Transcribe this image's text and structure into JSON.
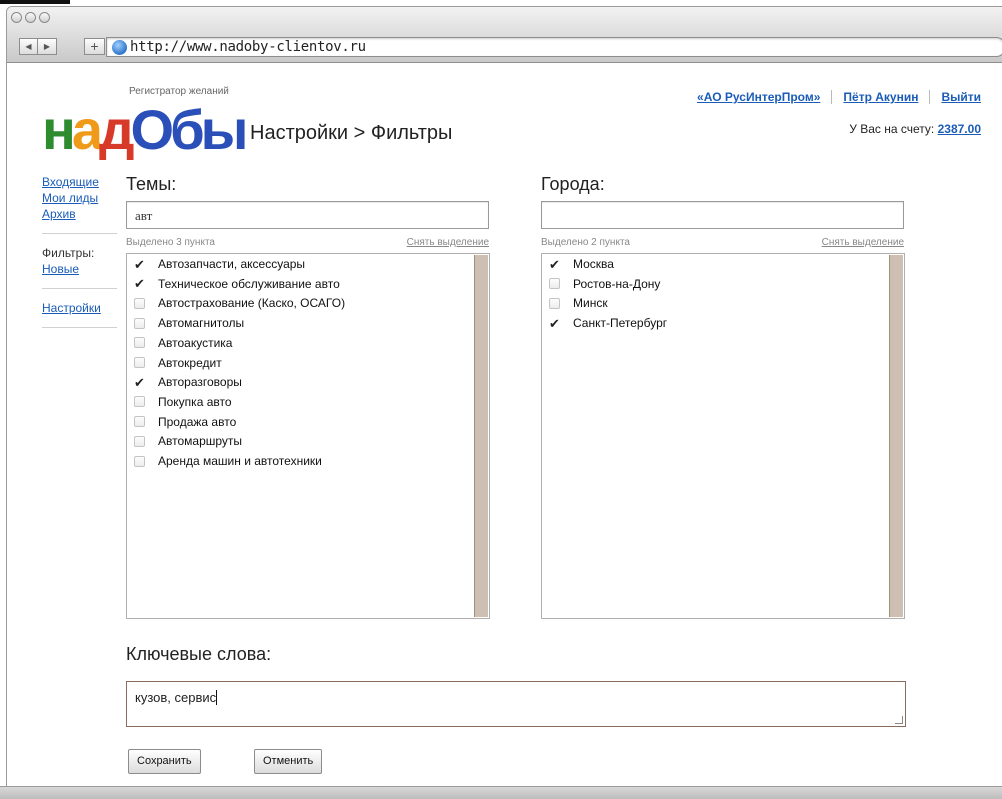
{
  "browser": {
    "url": "http://www.nadoby-clientov.ru",
    "back_glyph": "◀",
    "forward_glyph": "▶",
    "add_glyph": "+"
  },
  "logo": {
    "tagline": "Регистратор желаний",
    "letters": [
      "н",
      "а",
      "д",
      "О",
      "бы"
    ],
    "colors": [
      "#2e8b2e",
      "#f09a1a",
      "#d83a2a",
      "#2b4fb8",
      "#2b4fb8"
    ]
  },
  "breadcrumb": "Настройки > Фильтры",
  "header": {
    "company_link": "«АО РусИнтерПром»",
    "user_link": "Пётр Акунин",
    "logout_link": "Выйти",
    "balance_label": "У Вас на счету:",
    "balance_value": "2387.00"
  },
  "sidebar": {
    "inbox": "Входящие",
    "my_leads": "Мои лиды",
    "archive": "Архив",
    "filters_label": "Фильтры:",
    "new_filter": "Новые",
    "settings": "Настройки"
  },
  "topics": {
    "title": "Темы:",
    "search_value": "авт",
    "selected_text": "Выделено 3 пункта",
    "clear_text": "Снять выделение",
    "items": [
      {
        "label": "Автозапчасти, аксессуары",
        "checked": true
      },
      {
        "label": "Техническое обслуживание авто",
        "checked": true
      },
      {
        "label": "Автострахование (Каско, ОСАГО)",
        "checked": false
      },
      {
        "label": "Автомагнитолы",
        "checked": false
      },
      {
        "label": "Автоакустика",
        "checked": false
      },
      {
        "label": "Автокредит",
        "checked": false
      },
      {
        "label": "Авторазговоры",
        "checked": true
      },
      {
        "label": "Покупка авто",
        "checked": false
      },
      {
        "label": "Продажа авто",
        "checked": false
      },
      {
        "label": "Автомаршруты",
        "checked": false
      },
      {
        "label": "Аренда машин и автотехники",
        "checked": false
      }
    ]
  },
  "cities": {
    "title": "Города:",
    "search_value": "",
    "selected_text": "Выделено 2 пункта",
    "clear_text": "Снять выделение",
    "items": [
      {
        "label": "Москва",
        "checked": true
      },
      {
        "label": "Ростов-на-Дону",
        "checked": false
      },
      {
        "label": "Минск",
        "checked": false
      },
      {
        "label": "Санкт-Петербург",
        "checked": true
      }
    ]
  },
  "keywords": {
    "title": "Ключевые слова:",
    "value": "кузов, сервис"
  },
  "buttons": {
    "save": "Сохранить",
    "cancel": "Отменить"
  },
  "check_glyph": "✔"
}
